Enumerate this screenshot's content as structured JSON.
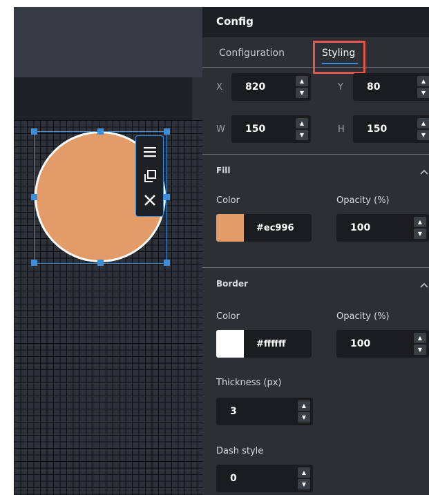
{
  "panel": {
    "title": "Config",
    "tabs": {
      "configuration": "Configuration",
      "styling": "Styling"
    },
    "active_tab": "Styling"
  },
  "position": {
    "x": {
      "label": "X",
      "value": "820"
    },
    "y": {
      "label": "Y",
      "value": "80"
    },
    "w": {
      "label": "W",
      "value": "150"
    },
    "h": {
      "label": "H",
      "value": "150"
    }
  },
  "fill": {
    "title": "Fill",
    "color_label": "Color",
    "color_value": "#ec996",
    "swatch_color": "#e39c67",
    "opacity_label": "Opacity (%)",
    "opacity_value": "100"
  },
  "border": {
    "title": "Border",
    "color_label": "Color",
    "color_value": "#ffffff",
    "swatch_color": "#ffffff",
    "opacity_label": "Opacity (%)",
    "opacity_value": "100",
    "thickness_label": "Thickness (px)",
    "thickness_value": "3",
    "dash_label": "Dash style",
    "dash_value": "0"
  },
  "shape_toolbar": {
    "icons": [
      "menu-icon",
      "duplicate-icon",
      "close-icon"
    ]
  },
  "colors": {
    "accent": "#3b8fe0",
    "highlight": "#e2564b",
    "shape_fill": "#e39c67",
    "shape_border": "#ffffff"
  }
}
